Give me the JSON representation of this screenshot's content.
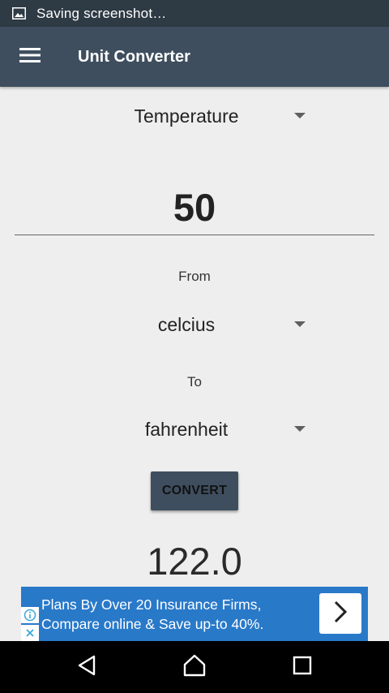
{
  "status_bar": {
    "icon": "image-icon",
    "text": "Saving screenshot…"
  },
  "app_bar": {
    "menu_icon": "hamburger-menu-icon",
    "title": "Unit Converter"
  },
  "category": {
    "selected": "Temperature"
  },
  "input": {
    "value": "50"
  },
  "from": {
    "label": "From",
    "selected": "celcius"
  },
  "to": {
    "label": "To",
    "selected": "fahrenheit"
  },
  "convert_button": {
    "label": "CONVERT"
  },
  "result": {
    "value": "122.0"
  },
  "ad": {
    "line1": "Plans By Over 20 Insurance Firms,",
    "line2": "Compare online & Save up-to 40%.",
    "icons": [
      "info-icon",
      "close-icon",
      "chevron-right-icon"
    ]
  },
  "nav_bar": {
    "icons": [
      "back-icon",
      "home-icon",
      "recents-icon"
    ]
  },
  "colors": {
    "status_bar": "#2e3a44",
    "app_bar": "#3e4e5e",
    "background": "#eeeeee",
    "ad": "#2979c9",
    "nav_bar": "#000000"
  }
}
